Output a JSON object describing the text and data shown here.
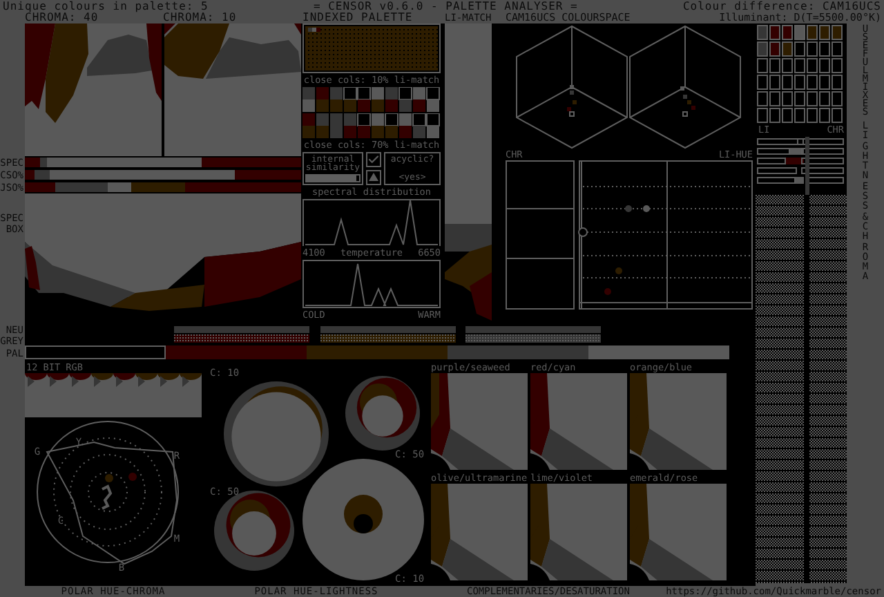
{
  "header": {
    "left": "Unique colours in palette: 5",
    "title": "= CENSOR v0.6.0 - PALETTE ANALYSER =",
    "right": "Colour difference: CAM16UCS",
    "illuminant": "Illuminant: D(T=5500.00°K)"
  },
  "palette": [
    {
      "color": "#000000"
    },
    {
      "color": "#330000"
    },
    {
      "color": "#2e1d00"
    },
    {
      "color": "#363636"
    },
    {
      "color": "#595959"
    }
  ],
  "chroma_plots": [
    {
      "label": "CHROMA: 40"
    },
    {
      "label": "CHROMA: 10"
    }
  ],
  "metric_bars": [
    {
      "label": "SPEC"
    },
    {
      "label": "CSO%"
    },
    {
      "label": "JSO%"
    }
  ],
  "spec_box": {
    "label": "SPEC BOX"
  },
  "indexed_palette": {
    "title": "INDEXED PALETTE"
  },
  "close_cols": [
    {
      "label": "close cols: 10% li-match"
    },
    {
      "label": "close cols: 70% li-match"
    }
  ],
  "internal_similarity": {
    "label": "internal similarity",
    "checked": true,
    "level": 0.95
  },
  "acyclic": {
    "label": "acyclic?",
    "value": "<yes>"
  },
  "spectral": {
    "title": "spectral distribution",
    "min": "4100",
    "max": "6650"
  },
  "temperature": {
    "title": "temperature",
    "min": "COLD",
    "max": "WARM"
  },
  "li_match": {
    "title": "LI-MATCH"
  },
  "colourspace": {
    "title": "CAM16UCS COLOURSPACE",
    "chr_label": "CHR",
    "li_hue_label": "LI-HUE"
  },
  "mixes": {
    "title": "USEFUL MIXES",
    "li_label": "LI",
    "chr_label": "CHR",
    "side_title": "LIGHTNESS & CHROMA"
  },
  "neutral_grey": {
    "label": "NEU GREY"
  },
  "pal": {
    "label": "PAL"
  },
  "rgb12": {
    "title": "12 BIT RGB"
  },
  "polar_chroma": {
    "title": "POLAR HUE-CHROMA",
    "hue_labels": [
      "G",
      "Y",
      "R",
      "C",
      "M",
      "B"
    ]
  },
  "polar_lightness": {
    "title": "POLAR HUE-LIGHTNESS",
    "discs": [
      {
        "label": "C: 10"
      },
      {
        "label": "C: 50"
      },
      {
        "label": "C: 50"
      },
      {
        "label": "C: 10"
      }
    ]
  },
  "complementaries": {
    "title": "COMPLEMENTARIES/DESATURATION",
    "pairs": [
      {
        "label": "purple/seaweed"
      },
      {
        "label": "red/cyan"
      },
      {
        "label": "orange/blue"
      },
      {
        "label": "olive/ultramarine"
      },
      {
        "label": "lime/violet"
      },
      {
        "label": "emerald/rose"
      }
    ]
  },
  "footer_url": "https://github.com/Quickmarble/censor"
}
